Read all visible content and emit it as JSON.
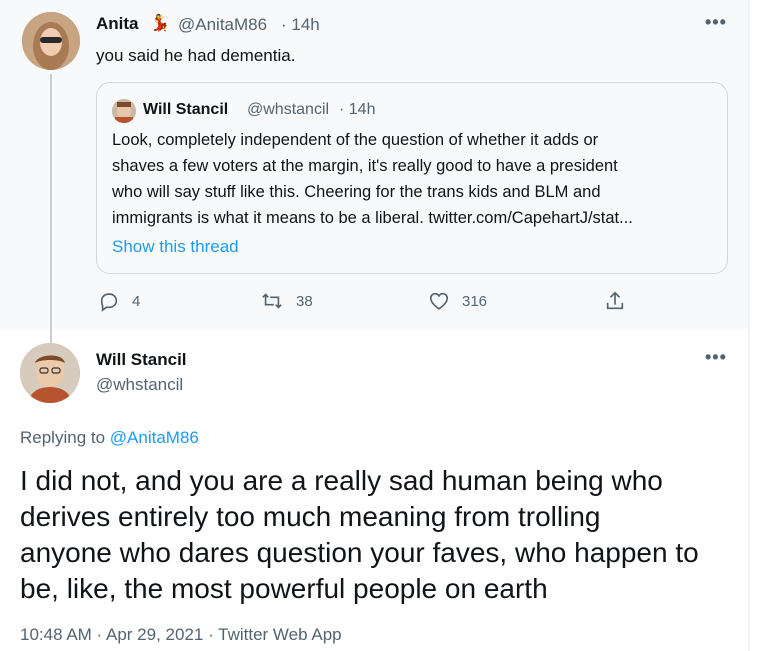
{
  "parent_tweet": {
    "name": "Anita",
    "emoji": "💃",
    "handle": "@AnitaM86",
    "time": "· 14h",
    "text": "you said he had dementia.",
    "more": "•••",
    "quote": {
      "name": "Will Stancil",
      "handle": "@whstancil",
      "time": "· 14h",
      "lines": [
        "Look, completely independent of the question of whether it adds or",
        "shaves a few voters at the margin, it's really good to have a president",
        "who will say stuff like this. Cheering for the trans kids and BLM and",
        "immigrants is what it means to be a liberal. twitter.com/CapehartJ/stat..."
      ],
      "show_thread": "Show this thread"
    },
    "actions": {
      "replies": "4",
      "retweets": "38",
      "likes": "316"
    }
  },
  "main_tweet": {
    "name": "Will Stancil",
    "handle": "@whstancil",
    "more": "•••",
    "replying_prefix": "Replying to",
    "replying_handle": "@AnitaM86",
    "lines": [
      "I did not, and you are a really sad human being who",
      "derives entirely too much meaning from trolling",
      "anyone who dares question your faves, who happen to",
      "be, like, the most powerful people on earth"
    ],
    "meta": "10:48 AM · Apr 29, 2021 · Twitter Web App"
  },
  "colors": {
    "link": "#1d9bf0",
    "muted": "#536471",
    "parent_bg": "#f7f9fa"
  }
}
